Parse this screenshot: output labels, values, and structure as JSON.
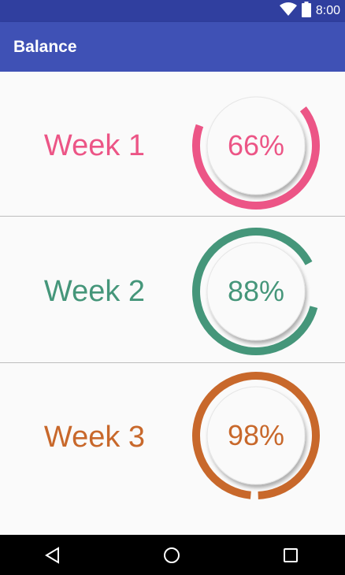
{
  "status_bar": {
    "time": "8:00"
  },
  "app_bar": {
    "title": "Balance"
  },
  "rows": [
    {
      "label": "Week 1",
      "percent_text": "66%",
      "progress": 0.66,
      "color": "#ec5586",
      "arc_start_deg": 322
    },
    {
      "label": "Week 2",
      "percent_text": "88%",
      "progress": 0.88,
      "color": "#45967a",
      "arc_start_deg": 15
    },
    {
      "label": "Week 3",
      "percent_text": "98%",
      "progress": 0.98,
      "color": "#c8682b",
      "arc_start_deg": 95
    }
  ],
  "icons": {
    "status": [
      "wifi-icon",
      "battery-icon"
    ],
    "nav": [
      "back-icon",
      "home-icon",
      "recents-icon"
    ]
  }
}
